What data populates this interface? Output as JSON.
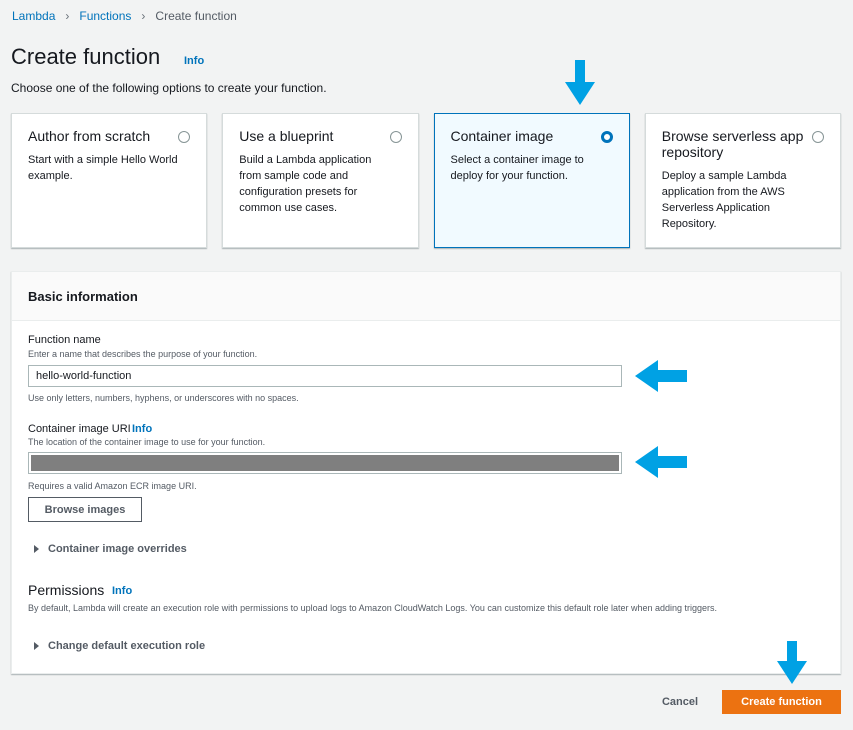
{
  "breadcrumb": {
    "items": [
      "Lambda",
      "Functions"
    ],
    "current": "Create function"
  },
  "page": {
    "title": "Create function",
    "info": "Info",
    "description": "Choose one of the following options to create your function."
  },
  "options": [
    {
      "title": "Author from scratch",
      "desc": "Start with a simple Hello World example.",
      "selected": false
    },
    {
      "title": "Use a blueprint",
      "desc": "Build a Lambda application from sample code and configuration presets for common use cases.",
      "selected": false
    },
    {
      "title": "Container image",
      "desc": "Select a container image to deploy for your function.",
      "selected": true
    },
    {
      "title": "Browse serverless app repository",
      "desc": "Deploy a sample Lambda application from the AWS Serverless Application Repository.",
      "selected": false
    }
  ],
  "basic_info": {
    "header": "Basic information",
    "function_name": {
      "label": "Function name",
      "desc": "Enter a name that describes the purpose of your function.",
      "value": "hello-world-function",
      "hint": "Use only letters, numbers, hyphens, or underscores with no spaces."
    },
    "image_uri": {
      "label": "Container image URI",
      "info": "Info",
      "desc": "The location of the container image to use for your function.",
      "hint": "Requires a valid Amazon ECR image URI."
    },
    "browse_button": "Browse images",
    "overrides": "Container image overrides",
    "permissions": {
      "title": "Permissions",
      "info": "Info",
      "desc": "By default, Lambda will create an execution role with permissions to upload logs to Amazon CloudWatch Logs. You can customize this default role later when adding triggers."
    },
    "change_role": "Change default execution role"
  },
  "footer": {
    "cancel": "Cancel",
    "create": "Create function"
  },
  "colors": {
    "accent": "#0073bb",
    "primary_button": "#ec7211",
    "annotation_arrow": "#00a1e4"
  }
}
